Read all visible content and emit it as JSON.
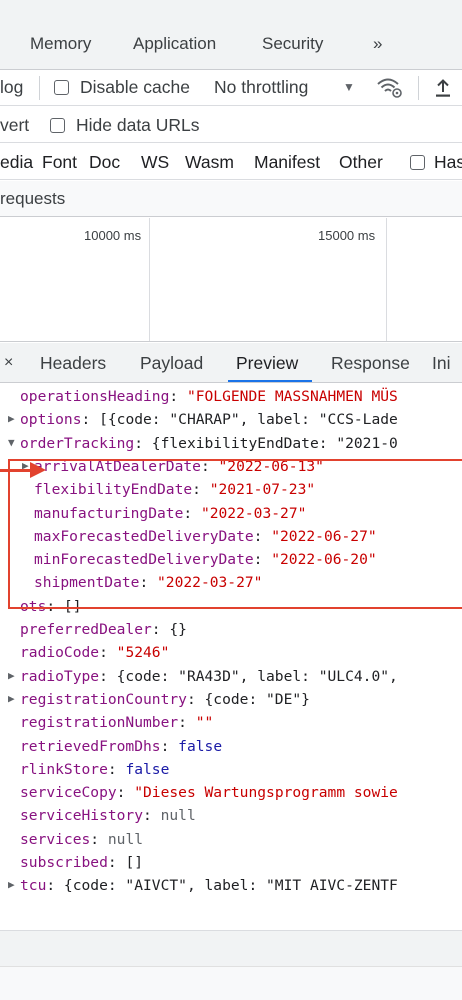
{
  "panel_tabs": [
    "Memory",
    "Application",
    "Security",
    "»"
  ],
  "toolbar": {
    "log_label": "log",
    "disable_cache_label": "Disable cache",
    "throttling_label": "No throttling",
    "dropdown_arrow": "▼"
  },
  "filter": {
    "invert_label": "vert",
    "hide_data_urls_label": "Hide data URLs"
  },
  "type_filters": [
    "edia",
    "Font",
    "Doc",
    "WS",
    "Wasm",
    "Manifest",
    "Other"
  ],
  "has_blocked_label": "Has",
  "requests_label": "requests",
  "timeline": {
    "labels": [
      "10000 ms",
      "15000 ms"
    ]
  },
  "detail_tabs": [
    "×",
    "Headers",
    "Payload",
    "Preview",
    "Response",
    "Ini"
  ],
  "active_detail_tab": "Preview",
  "preview_lines": [
    [
      {
        "c": "k",
        "t": "operationsHeading"
      },
      {
        "c": "p",
        "t": ": "
      },
      {
        "c": "s",
        "t": "\"FOLGENDE MASSNAHMEN MÜS"
      }
    ],
    [
      {
        "c": "k",
        "t": "options"
      },
      {
        "c": "p",
        "t": ": [{code: \"CHARAP\", label: \"CCS-Lade"
      }
    ],
    [
      {
        "c": "k",
        "t": "orderTracking"
      },
      {
        "c": "p",
        "t": ": {flexibilityEndDate: \"2021-0"
      }
    ],
    [
      {
        "c": "k",
        "t": "arrivalAtDealerDate"
      },
      {
        "c": "p",
        "t": ": "
      },
      {
        "c": "s",
        "t": "\"2022-06-13\""
      }
    ],
    [
      {
        "c": "k",
        "t": "flexibilityEndDate"
      },
      {
        "c": "p",
        "t": ": "
      },
      {
        "c": "s",
        "t": "\"2021-07-23\""
      }
    ],
    [
      {
        "c": "k",
        "t": "manufacturingDate"
      },
      {
        "c": "p",
        "t": ": "
      },
      {
        "c": "s",
        "t": "\"2022-03-27\""
      }
    ],
    [
      {
        "c": "k",
        "t": "maxForecastedDeliveryDate"
      },
      {
        "c": "p",
        "t": ": "
      },
      {
        "c": "s",
        "t": "\"2022-06-27\""
      }
    ],
    [
      {
        "c": "k",
        "t": "minForecastedDeliveryDate"
      },
      {
        "c": "p",
        "t": ": "
      },
      {
        "c": "s",
        "t": "\"2022-06-20\""
      }
    ],
    [
      {
        "c": "k",
        "t": "shipmentDate"
      },
      {
        "c": "p",
        "t": ": "
      },
      {
        "c": "s",
        "t": "\"2022-03-27\""
      }
    ],
    [
      {
        "c": "k",
        "t": "ots"
      },
      {
        "c": "p",
        "t": ": []"
      }
    ],
    [
      {
        "c": "k",
        "t": "preferredDealer"
      },
      {
        "c": "p",
        "t": ": {}"
      }
    ],
    [
      {
        "c": "k",
        "t": "radioCode"
      },
      {
        "c": "p",
        "t": ": "
      },
      {
        "c": "s",
        "t": "\"5246\""
      }
    ],
    [
      {
        "c": "k",
        "t": "radioType"
      },
      {
        "c": "p",
        "t": ": {code: \"RA43D\", label: \"ULC4.0\","
      }
    ],
    [
      {
        "c": "k",
        "t": "registrationCountry"
      },
      {
        "c": "p",
        "t": ": {code: \"DE\"}"
      }
    ],
    [
      {
        "c": "k",
        "t": "registrationNumber"
      },
      {
        "c": "p",
        "t": ": "
      },
      {
        "c": "s",
        "t": "\"\""
      }
    ],
    [
      {
        "c": "k",
        "t": "retrievedFromDhs"
      },
      {
        "c": "p",
        "t": ": "
      },
      {
        "c": "n",
        "t": "false"
      }
    ],
    [
      {
        "c": "k",
        "t": "rlinkStore"
      },
      {
        "c": "p",
        "t": ": "
      },
      {
        "c": "n",
        "t": "false"
      }
    ],
    [
      {
        "c": "k",
        "t": "serviceCopy"
      },
      {
        "c": "p",
        "t": ": "
      },
      {
        "c": "s",
        "t": "\"Dieses Wartungsprogramm sowie"
      }
    ],
    [
      {
        "c": "k",
        "t": "serviceHistory"
      },
      {
        "c": "p",
        "t": ": "
      },
      {
        "c": "nl",
        "t": "null"
      }
    ],
    [
      {
        "c": "k",
        "t": "services"
      },
      {
        "c": "p",
        "t": ": "
      },
      {
        "c": "nl",
        "t": "null"
      }
    ],
    [
      {
        "c": "k",
        "t": "subscribed"
      },
      {
        "c": "p",
        "t": ": []"
      }
    ],
    [
      {
        "c": "k",
        "t": "tcu"
      },
      {
        "c": "p",
        "t": ": {code: \"AIVCT\", label: \"MIT AIVC-ZENTF"
      }
    ]
  ],
  "line_indent": [
    1,
    0,
    0,
    2,
    2,
    2,
    2,
    2,
    2,
    1,
    1,
    1,
    0,
    0,
    1,
    1,
    1,
    1,
    1,
    1,
    1,
    0
  ],
  "line_toggle": [
    "",
    "collapsed",
    "expanded",
    "collapsed",
    "",
    "",
    "",
    "",
    "",
    "",
    "",
    "",
    "collapsed",
    "collapsed",
    "",
    "",
    "",
    "",
    "",
    "",
    "",
    "collapsed"
  ],
  "colors": {
    "key": "#881280",
    "string": "#c80000",
    "keyword": "#1a1aa6",
    "annotation": "#e2422e",
    "accent": "#1a73e8"
  }
}
